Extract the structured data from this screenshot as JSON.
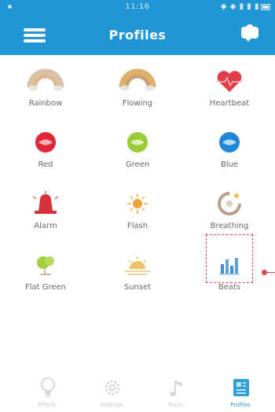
{
  "status_bar": {
    "time": "11:16",
    "icons_text": "◆ ◆ ▮ ▮ ▮"
  },
  "header": {
    "title": "Profiles",
    "menu_icon": "hamburger-menu-icon",
    "action_icon": "chat-bubble-icon"
  },
  "profiles": [
    {
      "label": "Rainbow",
      "icon": "rainbow-icon",
      "color": "#c9a07a"
    },
    {
      "label": "Flowing",
      "icon": "flowing-rainbow-icon",
      "color": "#d7a34f"
    },
    {
      "label": "Heartbeat",
      "icon": "heart-icon",
      "color": "#e33d4a"
    },
    {
      "label": "Red",
      "icon": "red-lips-icon",
      "color": "#e1283a"
    },
    {
      "label": "Green",
      "icon": "green-lips-icon",
      "color": "#9ccb3a"
    },
    {
      "label": "Blue",
      "icon": "blue-lips-icon",
      "color": "#1e87d8"
    },
    {
      "label": "Alarm",
      "icon": "alarm-icon",
      "color": "#d6323a"
    },
    {
      "label": "Flash",
      "icon": "flash-icon",
      "color": "#f2a23c"
    },
    {
      "label": "Breathing",
      "icon": "breathing-icon",
      "color": "#b9a28a"
    },
    {
      "label": "Flat Green",
      "icon": "flat-green-icon",
      "color": "#a4cf3c"
    },
    {
      "label": "Sunset",
      "icon": "sunset-icon",
      "color": "#f1c06a"
    },
    {
      "label": "Beats",
      "icon": "beats-bars-icon",
      "color": "#3f8fd6"
    }
  ],
  "selected_profile": "Beats",
  "bottom_nav": [
    {
      "label": "Effects",
      "icon": "lamp-icon"
    },
    {
      "label": "Settings",
      "icon": "gear-icon"
    },
    {
      "label": "Music",
      "icon": "music-icon"
    },
    {
      "label": "Profiles",
      "icon": "profiles-icon",
      "active": true
    }
  ],
  "colors": {
    "primary": "#2196d7",
    "selection": "#e0484c",
    "label_gray": "#686868"
  }
}
